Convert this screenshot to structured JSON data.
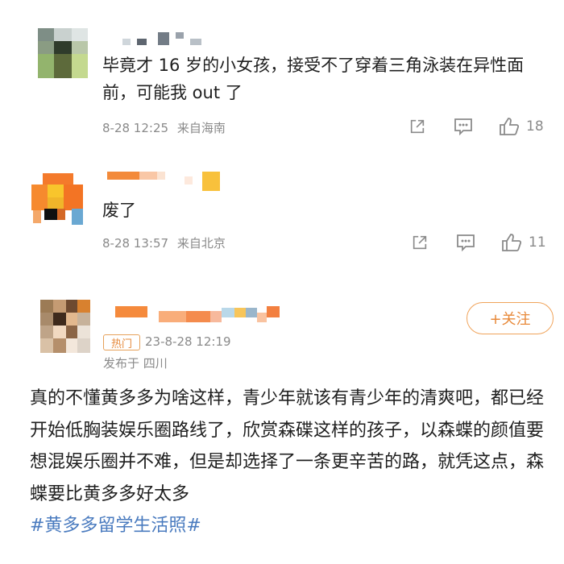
{
  "comments": [
    {
      "text": "毕竟才 16 岁的小女孩，接受不了穿着三角泳装在异性面前，可能我 out 了",
      "time": "8-28 12:25",
      "location": "来自海南",
      "likes": "18"
    },
    {
      "text": "废了",
      "time": "8-28 13:57",
      "location": "来自北京",
      "likes": "11"
    }
  ],
  "post": {
    "follow_label": "+关注",
    "hot_tag": "热门",
    "time": "23-8-28 12:19",
    "location": "发布于 四川",
    "body": "真的不懂黄多多为啥这样，青少年就该有青少年的清爽吧，都已经开始低胸装娱乐圈路线了，欣赏森碟这样的孩子，以森蝶的颜值要想混娱乐圈并不难，但是却选择了一条更辛苦的路，就凭这点，森蝶要比黄多多好太多",
    "hashtag": "#黄多多留学生活照#"
  },
  "icons": {
    "share": "share-icon",
    "comment": "comment-icon",
    "like": "thumbs-up-icon"
  },
  "colors": {
    "accent_orange": "#e8893a",
    "hashtag_blue": "#4a7bbf",
    "meta_gray": "#8a8a8a"
  }
}
